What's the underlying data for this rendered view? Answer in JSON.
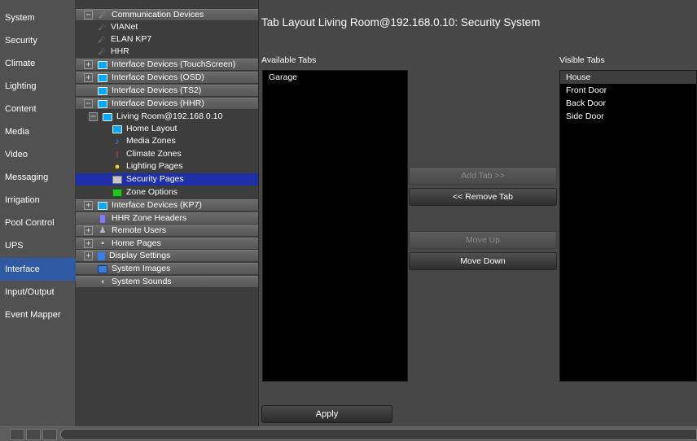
{
  "nav": {
    "items": [
      {
        "label": "System"
      },
      {
        "label": "Security"
      },
      {
        "label": "Climate"
      },
      {
        "label": "Lighting"
      },
      {
        "label": "Content"
      },
      {
        "label": "Media"
      },
      {
        "label": "Video"
      },
      {
        "label": "Messaging"
      },
      {
        "label": "Irrigation"
      },
      {
        "label": "Pool Control"
      },
      {
        "label": "UPS"
      },
      {
        "label": "Interface"
      },
      {
        "label": "Input/Output"
      },
      {
        "label": "Event Mapper"
      }
    ],
    "active_label": "Interface"
  },
  "tree": {
    "communication_devices": "Communication Devices",
    "vianet": "VIANet",
    "elan_kp7": "ELAN KP7",
    "hhr": "HHR",
    "interface_touchscreen": "Interface Devices (TouchScreen)",
    "interface_osd": "Interface Devices (OSD)",
    "interface_ts2": "Interface Devices (TS2)",
    "interface_hhr": "Interface Devices (HHR)",
    "living_room": "Living Room@192.168.0.10",
    "home_layout": "Home Layout",
    "media_zones": "Media Zones",
    "climate_zones": "Climate Zones",
    "lighting_pages": "Lighting Pages",
    "security_pages": "Security Pages",
    "zone_options": "Zone Options",
    "interface_kp7": "Interface Devices (KP7)",
    "hhr_zone_headers": "HHR Zone Headers",
    "remote_users": "Remote Users",
    "home_pages": "Home Pages",
    "display_settings": "Display Settings",
    "system_images": "System Images",
    "system_sounds": "System Sounds",
    "plus": "+",
    "minus": "−"
  },
  "main": {
    "title": "Tab Layout Living Room@192.168.0.10: Security System",
    "available_label": "Available Tabs",
    "visible_label": "Visible Tabs",
    "available_tabs": [
      "Garage"
    ],
    "visible_tabs": [
      "House",
      "Front Door",
      "Back Door",
      "Side Door"
    ],
    "add_tab": "Add Tab >>",
    "remove_tab": "<< Remove Tab",
    "move_up": "Move Up",
    "move_down": "Move Down",
    "apply": "Apply"
  },
  "icons": {
    "satellite": "satellite-icon",
    "screen": "screen-icon",
    "note": "music-note-icon",
    "thermometer": "thermometer-icon",
    "bulb": "bulb-icon",
    "page": "page-icon",
    "zone": "zone-icon",
    "users": "users-icon",
    "home": "home-icon",
    "display": "display-icon",
    "images": "images-icon",
    "sound": "sound-icon"
  },
  "colors": {
    "active_nav": "#2f5aa3",
    "selected_tree": "#1f2fa8",
    "group_row": "#626262"
  }
}
